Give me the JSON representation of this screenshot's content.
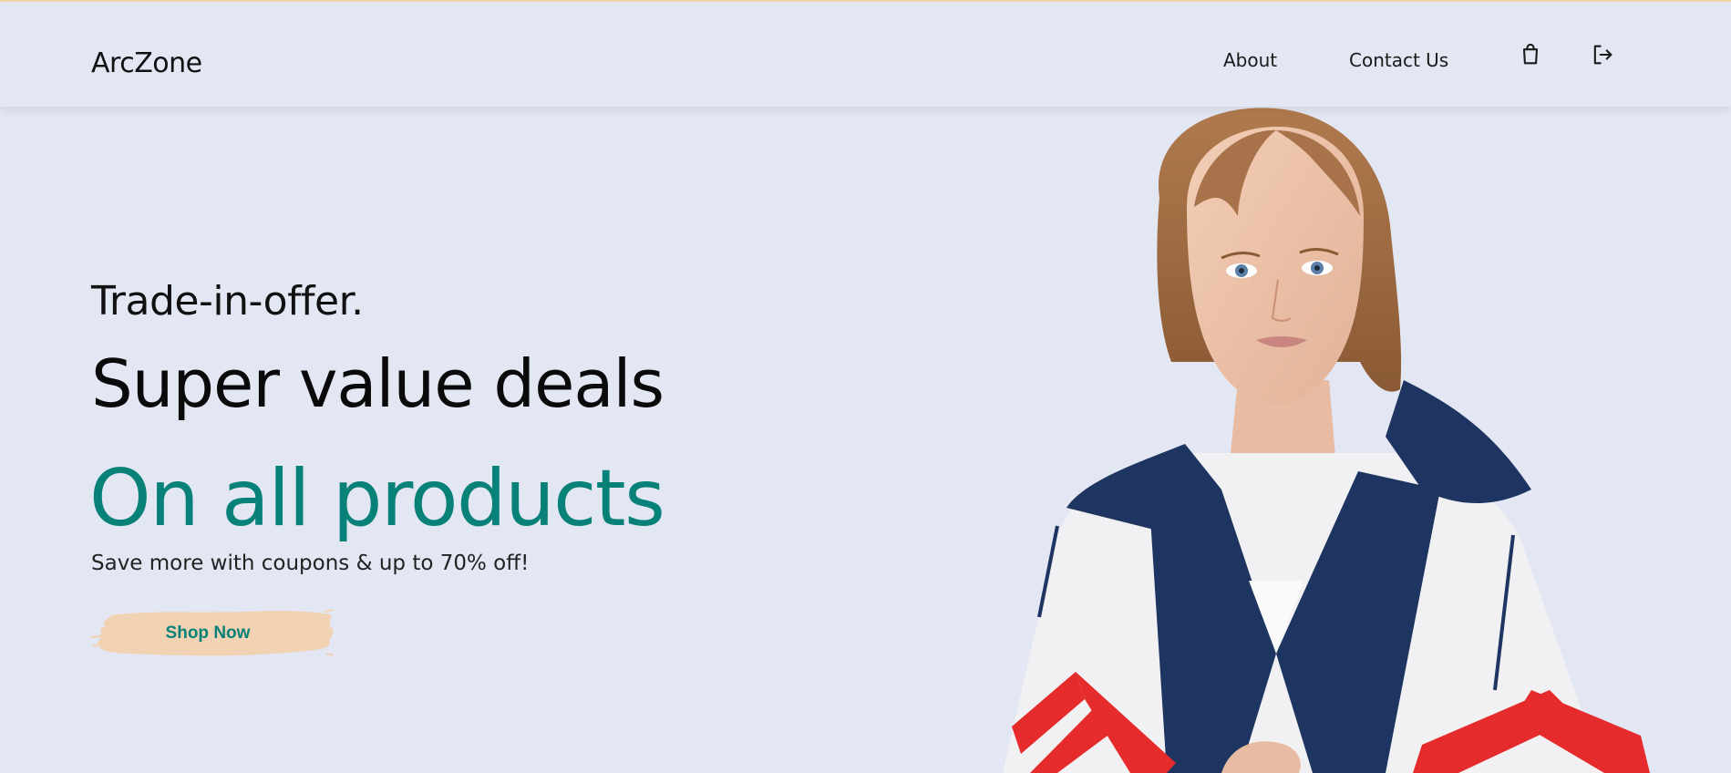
{
  "header": {
    "logo": "ArcZone",
    "nav": {
      "about": "About",
      "contact": "Contact Us"
    },
    "icons": [
      "shopping-bag-icon",
      "logout-icon"
    ]
  },
  "hero": {
    "eyebrow": "Trade-in-offer.",
    "headline": "Super value deals",
    "highlight": "On all products",
    "subtext": "Save more with coupons & up to 70% off!",
    "cta_label": "Shop Now"
  },
  "colors": {
    "background": "#e3e6f3",
    "accent": "#088178",
    "cta_brush": "#f1d3b3",
    "top_border": "#f3d9a8"
  }
}
